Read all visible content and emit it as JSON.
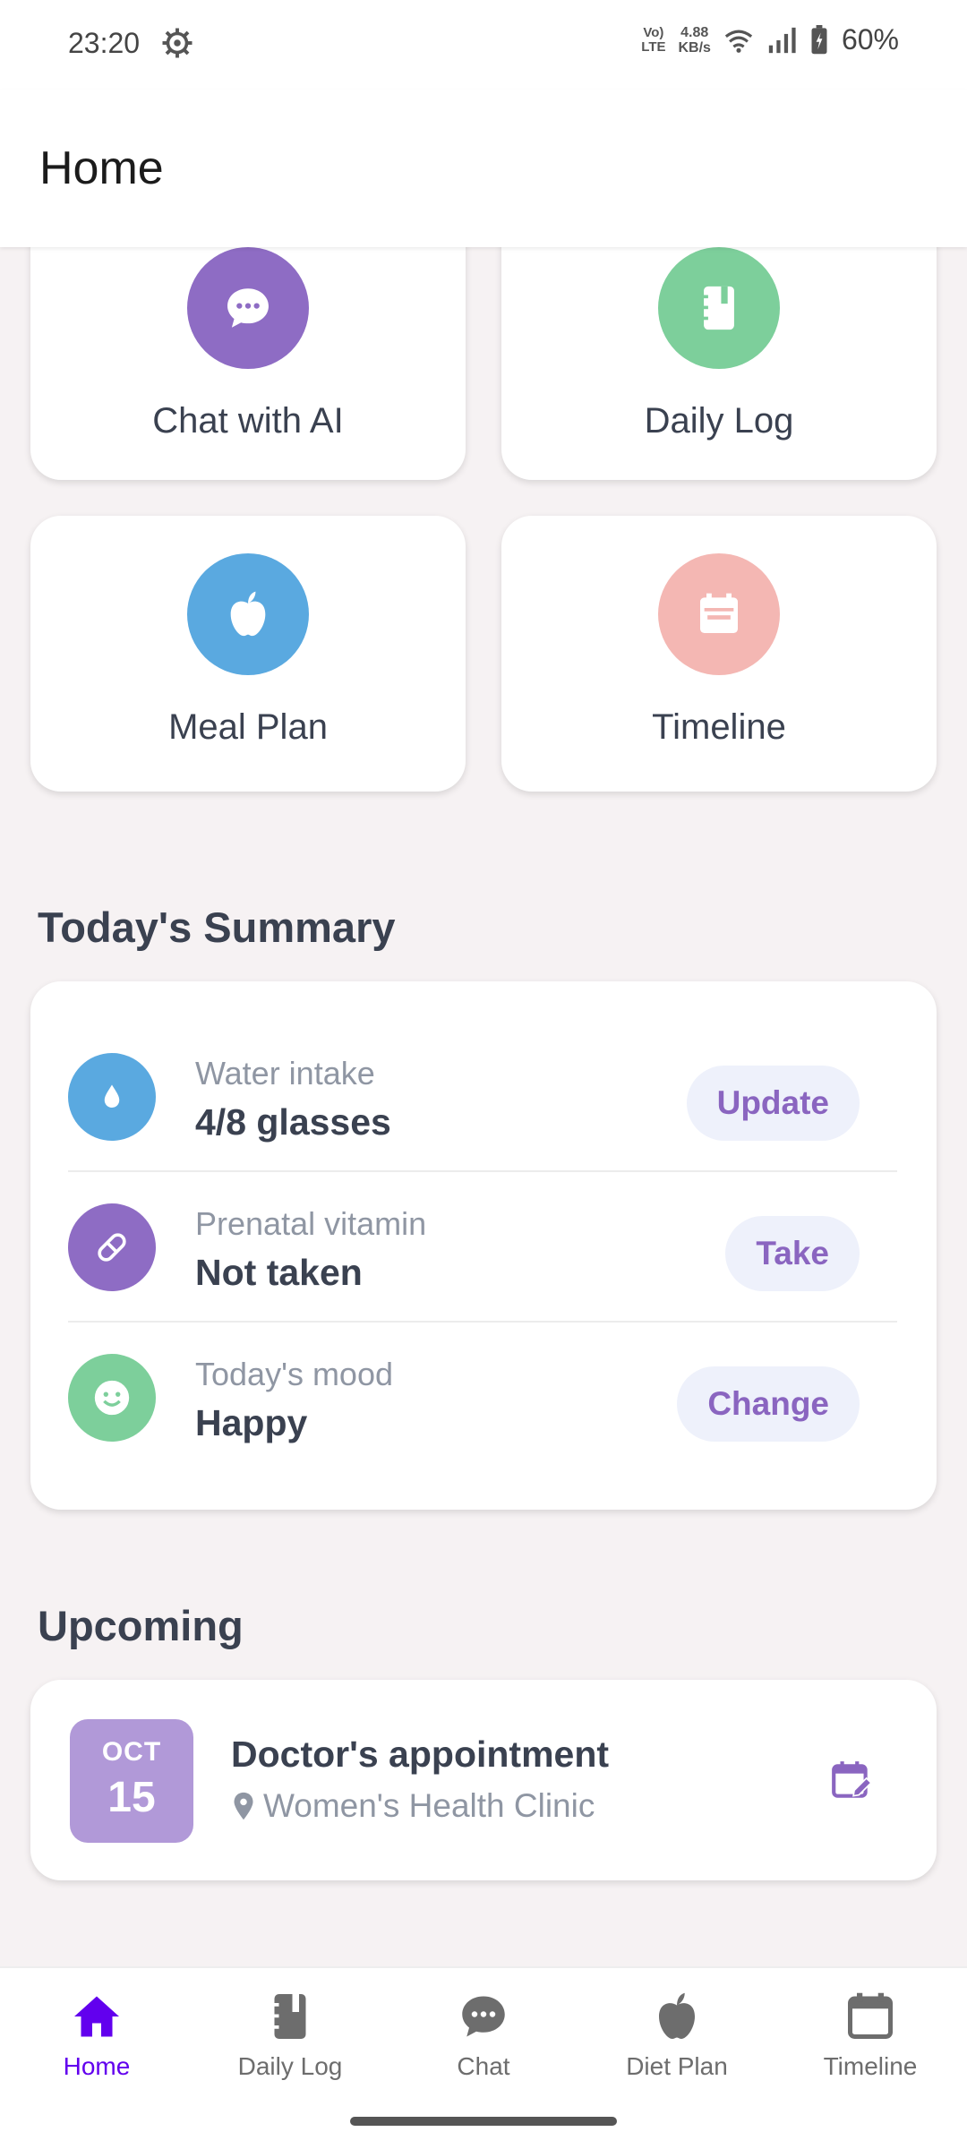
{
  "status_bar": {
    "time": "23:20",
    "network_label_top": "Vo)",
    "network_label_bottom": "LTE",
    "speed_top": "4.88",
    "speed_bottom": "KB/s",
    "battery": "60%"
  },
  "header": {
    "title": "Home"
  },
  "features": [
    {
      "label": "Chat with AI",
      "icon": "chat-icon",
      "color": "#8e6cc4"
    },
    {
      "label": "Daily Log",
      "icon": "notebook-icon",
      "color": "#7dcf9b"
    },
    {
      "label": "Meal Plan",
      "icon": "apple-icon",
      "color": "#5aa9e0"
    },
    {
      "label": "Timeline",
      "icon": "calendar-icon",
      "color": "#f4b7b3"
    }
  ],
  "summary": {
    "title": "Today's Summary",
    "items": [
      {
        "label": "Water intake",
        "value": "4/8 glasses",
        "action": "Update",
        "icon": "water-drop-icon",
        "color": "#5aa9e0"
      },
      {
        "label": "Prenatal vitamin",
        "value": "Not taken",
        "action": "Take",
        "icon": "pill-icon",
        "color": "#8e6cc4"
      },
      {
        "label": "Today's mood",
        "value": "Happy",
        "action": "Change",
        "icon": "smiley-icon",
        "color": "#7dcf9b"
      }
    ]
  },
  "upcoming": {
    "title": "Upcoming",
    "items": [
      {
        "month": "OCT",
        "day": "15",
        "title": "Doctor's appointment",
        "location": "Women's Health Clinic",
        "icon": "edit-calendar-icon"
      }
    ]
  },
  "bottom_nav": {
    "items": [
      {
        "label": "Home",
        "icon": "home-icon",
        "active": true
      },
      {
        "label": "Daily Log",
        "icon": "notebook-icon",
        "active": false
      },
      {
        "label": "Chat",
        "icon": "chat-icon",
        "active": false
      },
      {
        "label": "Diet Plan",
        "icon": "apple-icon",
        "active": false
      },
      {
        "label": "Timeline",
        "icon": "calendar-icon",
        "active": false
      }
    ],
    "active_color": "#6200ee",
    "inactive_color": "#6d6d6d"
  }
}
